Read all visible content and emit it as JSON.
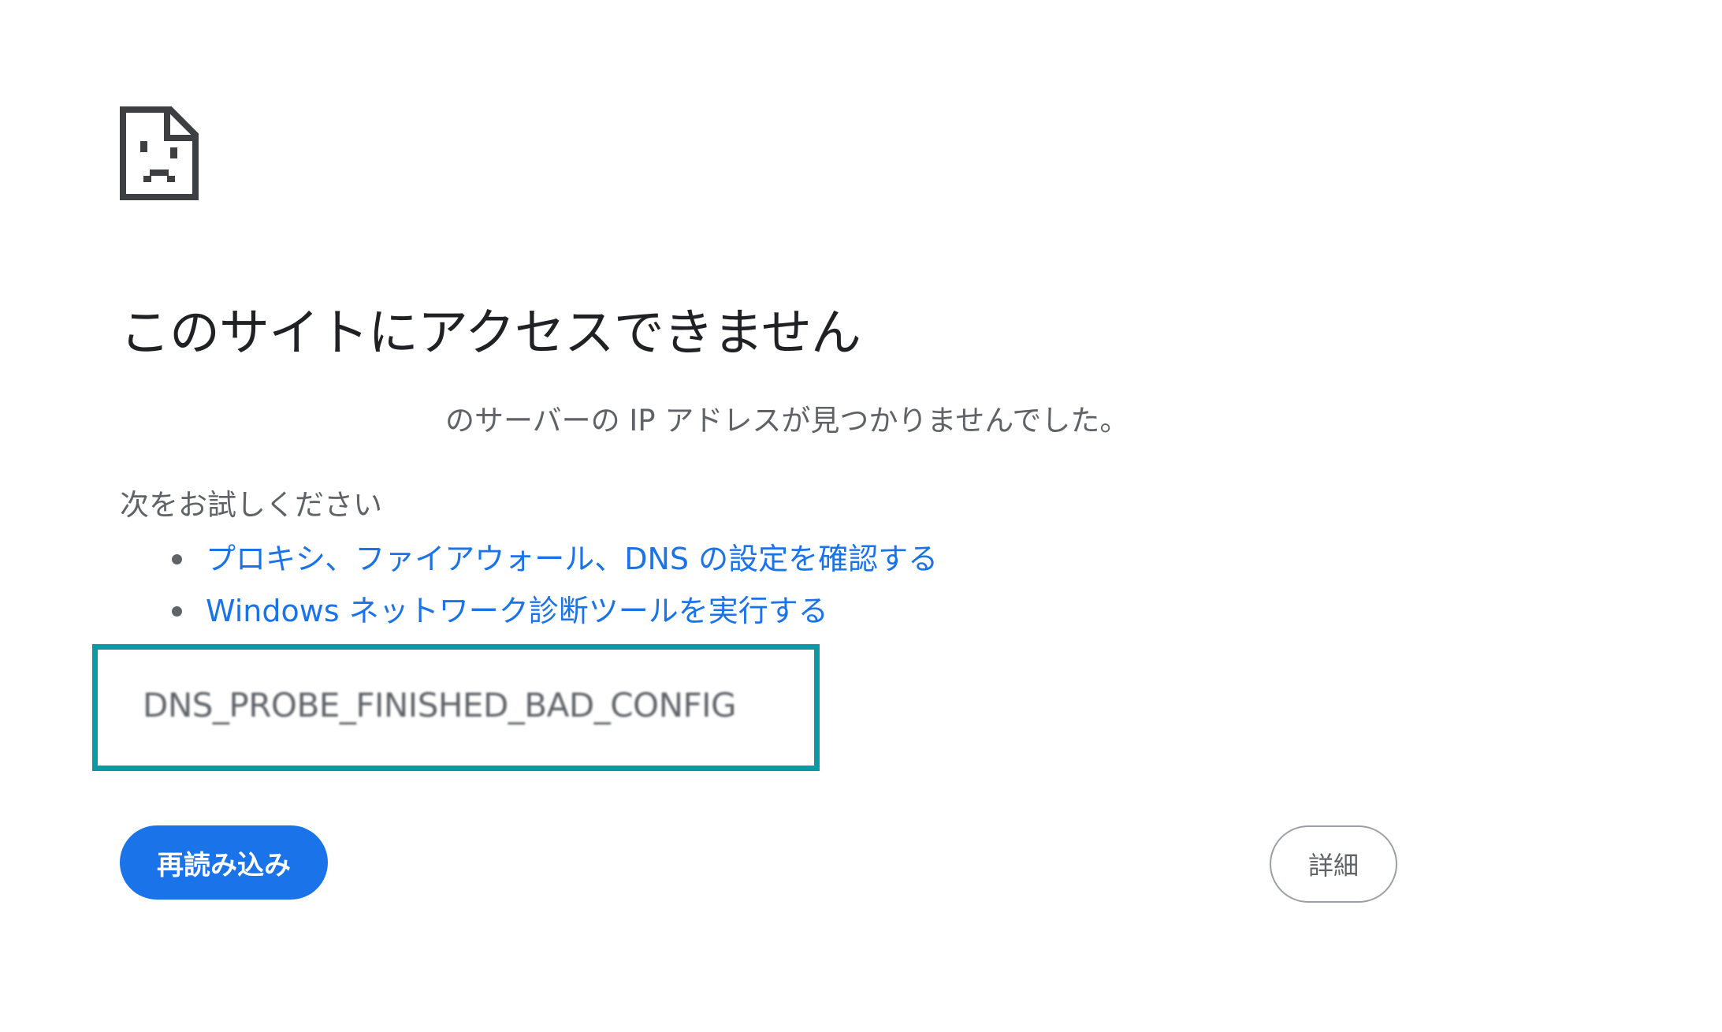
{
  "icon": "sad-page-icon",
  "heading": "このサイトにアクセスできません",
  "subtext": "のサーバーの IP アドレスが見つかりませんでした。",
  "try_label": "次をお試しください",
  "suggestions": [
    {
      "label": "プロキシ、ファイアウォール、DNS の設定を確認する"
    },
    {
      "label": "Windows ネットワーク診断ツールを実行する"
    }
  ],
  "error_code": "DNS_PROBE_FINISHED_BAD_CONFIG",
  "reload_label": "再読み込み",
  "details_label": "詳細",
  "colors": {
    "accent": "#1a73e8",
    "highlight_border": "#0b9aa5",
    "text_secondary": "#5f6368",
    "text_primary": "#202124"
  }
}
